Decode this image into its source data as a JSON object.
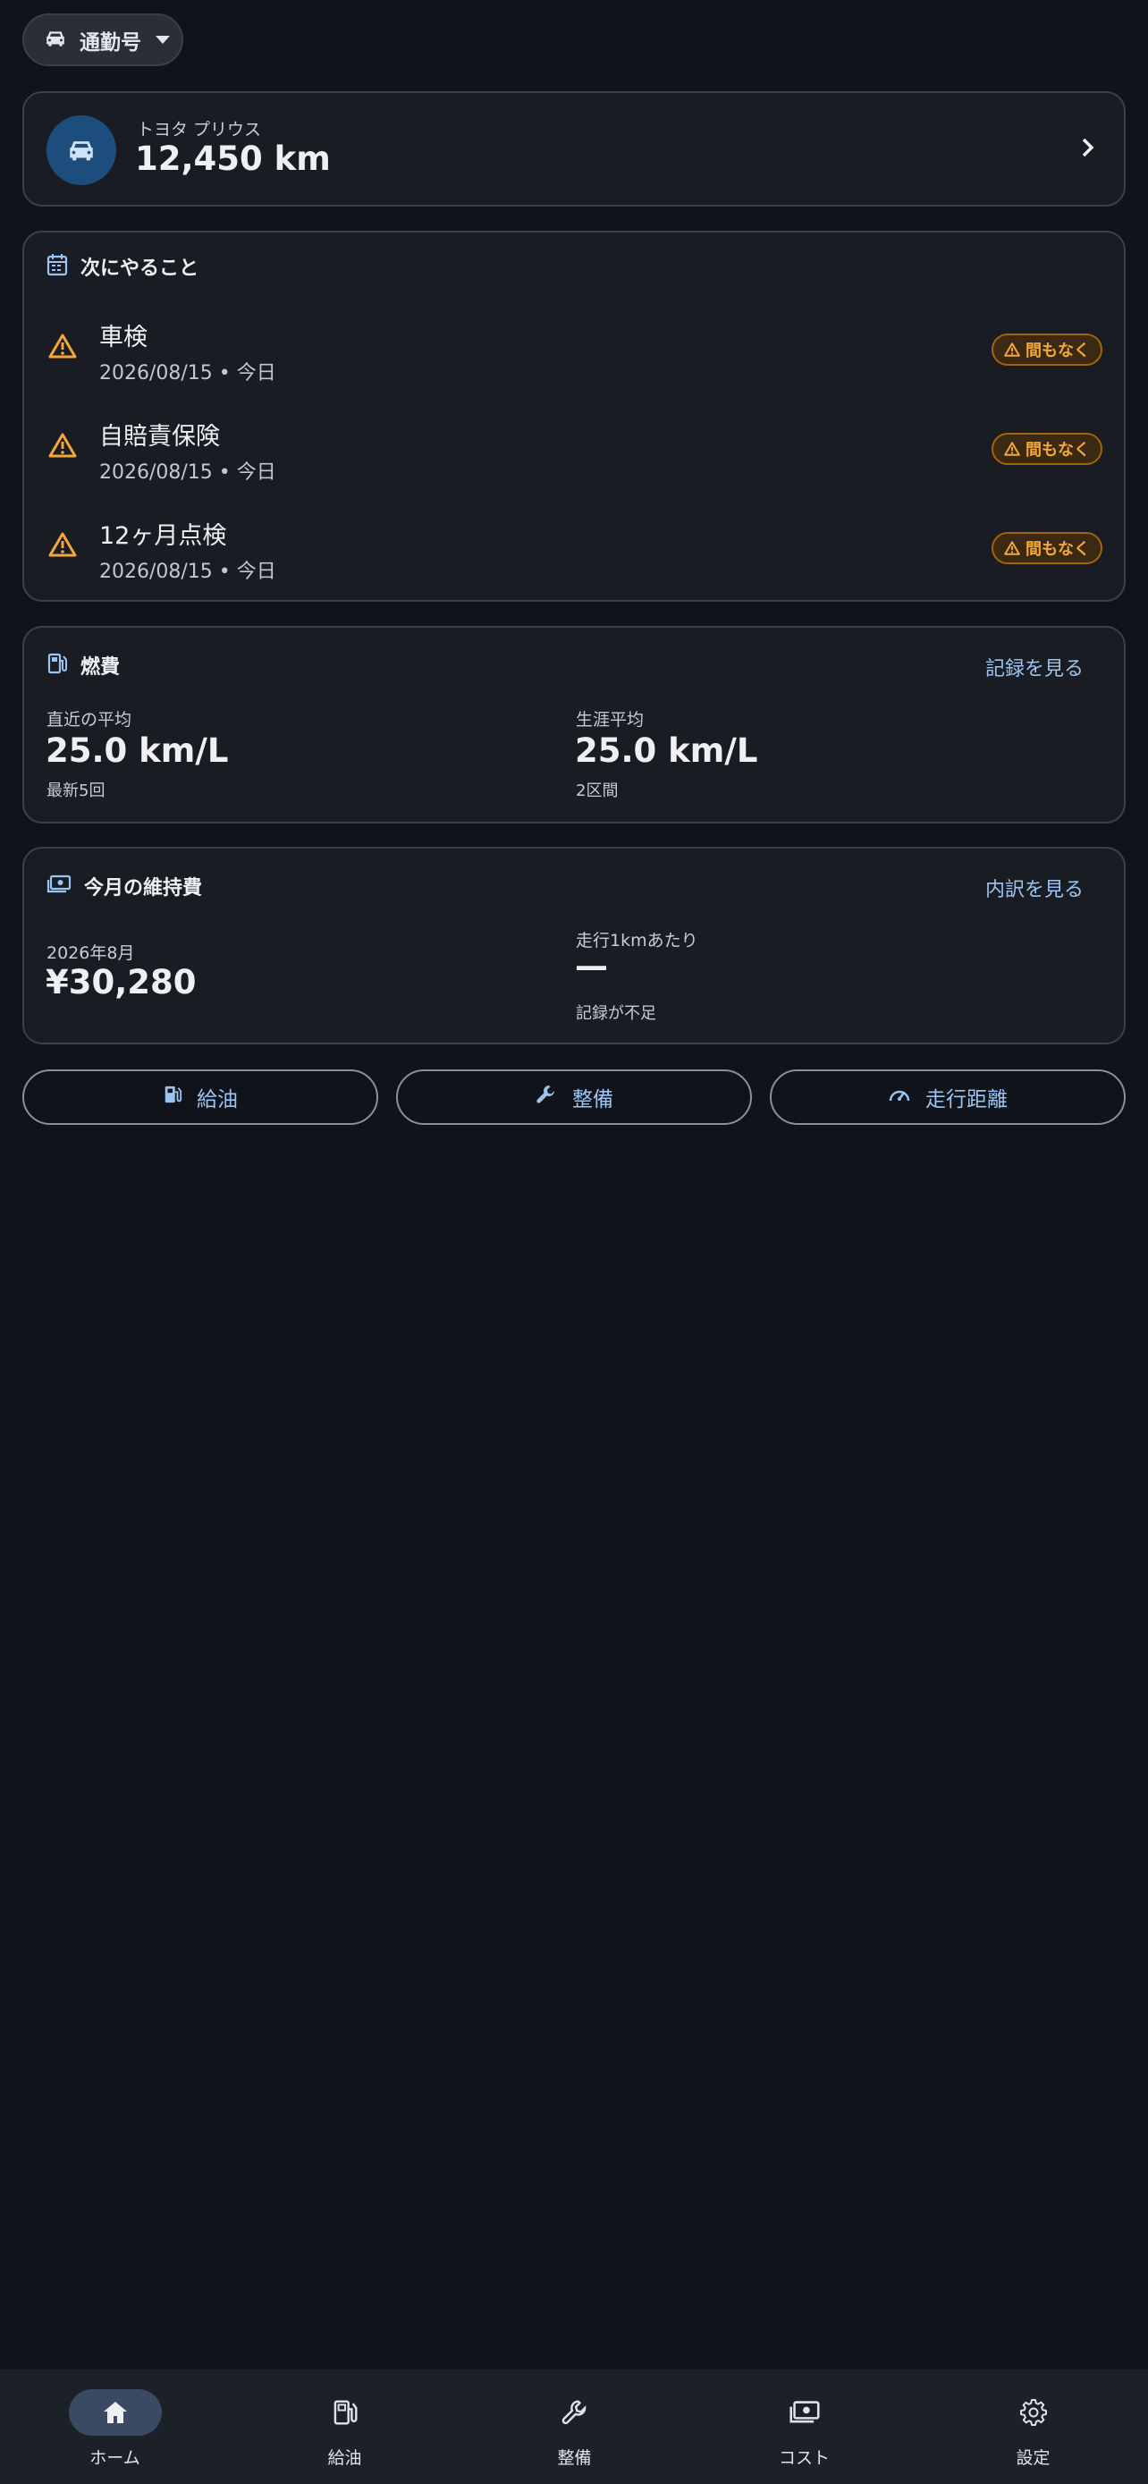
{
  "vehicle_selector": {
    "label": "通勤号"
  },
  "vehicle": {
    "name": "トヨタ プリウス",
    "odometer": "12,450 km"
  },
  "todo": {
    "title": "次にやること",
    "items": [
      {
        "title": "車検",
        "due": "2026/08/15 • 今日",
        "badge": "間もなく"
      },
      {
        "title": "自賠責保険",
        "due": "2026/08/15 • 今日",
        "badge": "間もなく"
      },
      {
        "title": "12ヶ月点検",
        "due": "2026/08/15 • 今日",
        "badge": "間もなく"
      }
    ]
  },
  "fuel": {
    "title": "燃費",
    "link": "記録を見る",
    "recent": {
      "label": "直近の平均",
      "value": "25.0 km/L",
      "sub": "最新5回"
    },
    "lifetime": {
      "label": "生涯平均",
      "value": "25.0 km/L",
      "sub": "2区間"
    }
  },
  "cost": {
    "title": "今月の維持費",
    "link": "内訳を見る",
    "month": {
      "label": "2026年8月",
      "value": "¥30,280"
    },
    "per_km": {
      "label": "走行1kmあたり",
      "value": "—",
      "sub": "記録が不足"
    }
  },
  "actions": {
    "fuel": "給油",
    "maintenance": "整備",
    "mileage": "走行距離"
  },
  "nav": {
    "home": "ホーム",
    "fuel": "給油",
    "maintenance": "整備",
    "cost": "コスト",
    "settings": "設定"
  },
  "colors": {
    "accent": "#9bc4f2",
    "warning": "#f3a63b",
    "background": "#10141a",
    "card": "#191c22"
  }
}
